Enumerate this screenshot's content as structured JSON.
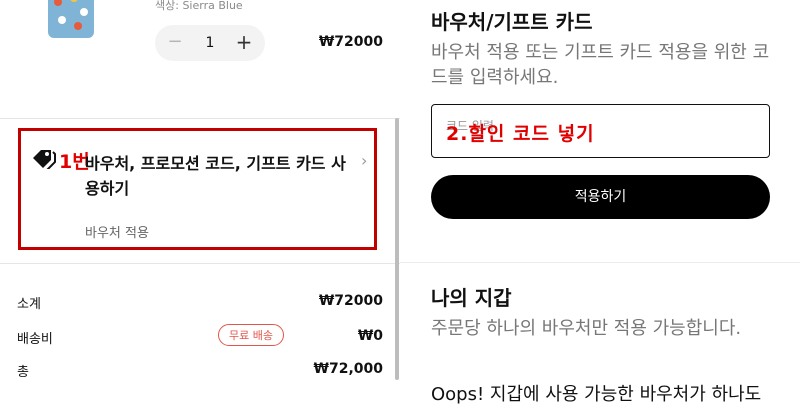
{
  "product": {
    "variant": "색상: Sierra Blue",
    "quantity": "1",
    "minus": "−",
    "plus": "+",
    "price": "₩72000"
  },
  "voucher": {
    "step_marker": "1번",
    "title": "바우처, 프로모션 코드, 기프트 카드 사용하기",
    "subtitle": "바우처 적용",
    "chevron": "›"
  },
  "summary": {
    "subtotal_label": "소계",
    "subtotal_value": "₩72000",
    "shipping_label": "배송비",
    "shipping_badge": "무료 배송",
    "shipping_value": "₩0",
    "total_label": "총",
    "total_value": "₩72,000"
  },
  "gift_card": {
    "title": "바우처/기프트 카드",
    "description": "바우처 적용 또는 기프트 카드 적용을 위한 코드를 입력하세요.",
    "input_placeholder": "코드 입력",
    "step_marker": "2.할인 코드 넣기",
    "apply_label": "적용하기"
  },
  "wallet": {
    "title": "나의 지갑",
    "description": "주문당 하나의 바우처만 적용 가능합니다.",
    "empty_message": "Oops! 지갑에 사용 가능한 바우처가 하나도"
  },
  "colors": {
    "accent_red": "#c30000",
    "button_black": "#000000",
    "badge_red": "#e0574b"
  }
}
